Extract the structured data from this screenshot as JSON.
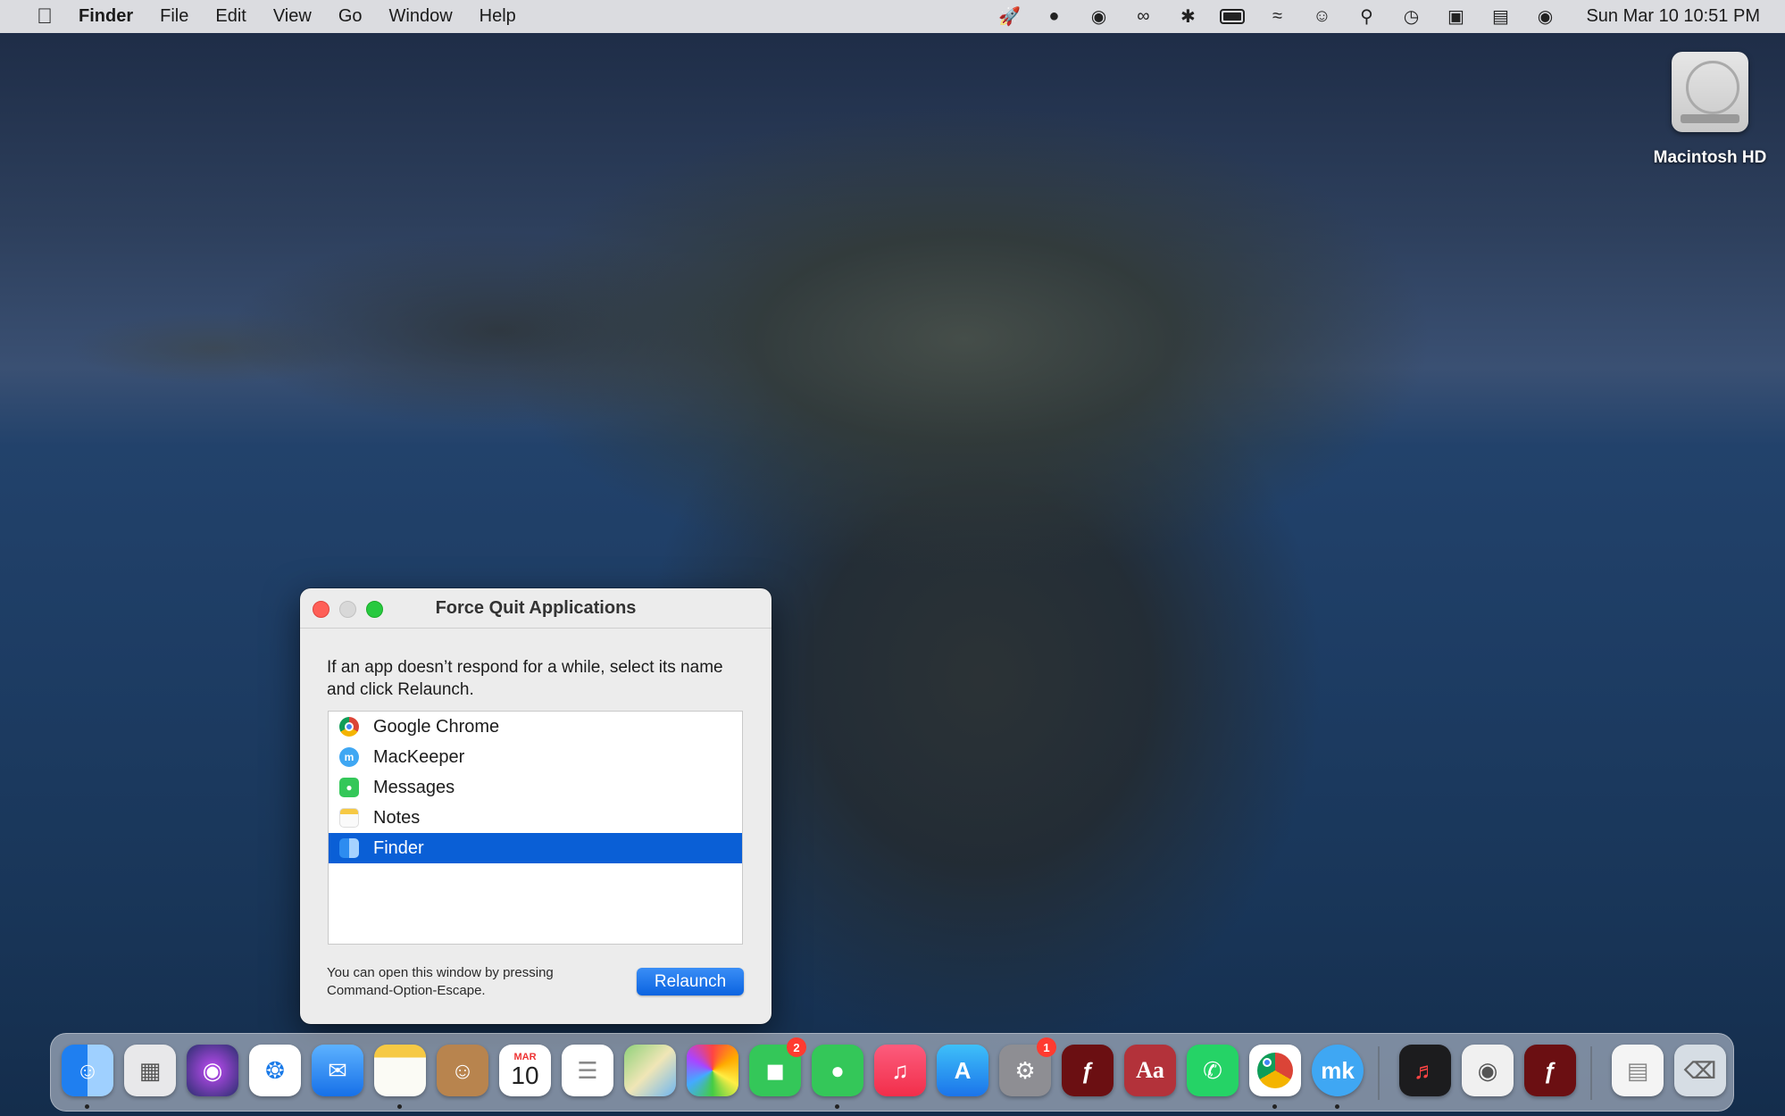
{
  "menubar": {
    "app_name": "Finder",
    "menus": [
      "File",
      "Edit",
      "View",
      "Go",
      "Window",
      "Help"
    ],
    "status_icons": [
      "rocket-icon",
      "text-assist-icon",
      "mackeeper-icon",
      "creative-cloud-icon",
      "bluetooth-icon",
      "battery-icon",
      "wifi-icon",
      "user-icon",
      "search-icon",
      "time-machine-icon",
      "display-icon",
      "control-center-icon",
      "siri-icon"
    ],
    "clock": "Sun Mar 10  10:51 PM"
  },
  "desktop": {
    "drive_label": "Macintosh HD"
  },
  "dialog": {
    "title": "Force Quit Applications",
    "instructions": "If an app doesn’t respond for a while, select its name and click Relaunch.",
    "apps": [
      {
        "name": "Google Chrome",
        "icon": "chrome-icon",
        "selected": false
      },
      {
        "name": "MacKeeper",
        "icon": "mackeeper-icon",
        "selected": false
      },
      {
        "name": "Messages",
        "icon": "messages-icon",
        "selected": false
      },
      {
        "name": "Notes",
        "icon": "notes-icon",
        "selected": false
      },
      {
        "name": "Finder",
        "icon": "finder-icon",
        "selected": true
      }
    ],
    "footer_note": "You can open this window by pressing Command-Option-Escape.",
    "button_label": "Relaunch"
  },
  "dock": {
    "calendar_month": "MAR",
    "calendar_day": "10",
    "facetime_badge": "2",
    "settings_badge": "1",
    "items": [
      "finder-icon",
      "launchpad-icon",
      "siri-icon",
      "safari-icon",
      "mail-icon",
      "notes-icon",
      "contacts-icon",
      "calendar-icon",
      "reminders-icon",
      "maps-icon",
      "photos-icon",
      "facetime-icon",
      "messages-icon",
      "music-icon",
      "app-store-icon",
      "system-preferences-icon",
      "flash-icon",
      "dictionary-icon",
      "whatsapp-icon",
      "chrome-icon",
      "mackeeper-icon",
      "voice-memos-icon",
      "disk-utility-icon",
      "flash-icon",
      "downloads-stack-icon",
      "trash-icon"
    ]
  }
}
